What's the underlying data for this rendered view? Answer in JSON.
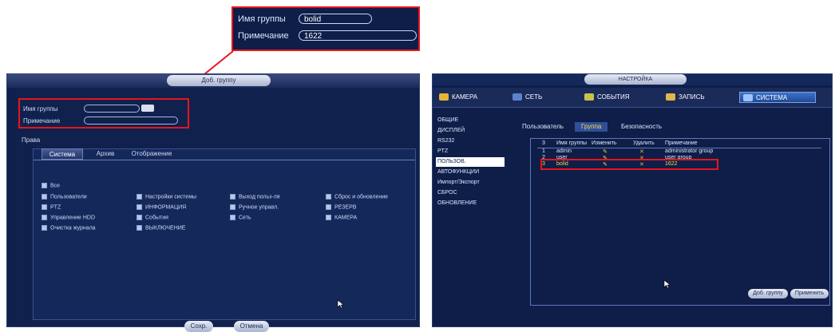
{
  "callout": {
    "group_name_label": "Имя группы",
    "group_name_value": "bolid",
    "note_label": "Примечание",
    "note_value": "1622"
  },
  "add_group_dialog": {
    "title": "Доб. группу",
    "group_name_label": "Имя группы",
    "note_label": "Примечание",
    "rights_label": "Права",
    "tabs": [
      "Система",
      "Архив",
      "Отображение"
    ],
    "checkboxes": [
      "Все",
      "Пользователи",
      "Настройки системы",
      "Выход польз-ля",
      "Сброс и обновление",
      "PTZ",
      "ИНФОРМАЦИЯ",
      "Ручное управл.",
      "РЕЗЕРВ",
      "Управление HDD",
      "События",
      "Сеть",
      "КАМЕРА",
      "Очистка журнала",
      "ВЫКЛЮЧЕНИЕ"
    ],
    "save_button": "Сохр.",
    "cancel_button": "Отмена"
  },
  "settings_window": {
    "title": "НАСТРОЙКА",
    "toolbar": [
      {
        "label": "КАМЕРА",
        "icon": "camera-icon"
      },
      {
        "label": "СЕТЬ",
        "icon": "network-icon"
      },
      {
        "label": "СОБЫТИЯ",
        "icon": "events-icon"
      },
      {
        "label": "ЗАПИСЬ",
        "icon": "record-icon"
      },
      {
        "label": "СИСТЕМА",
        "icon": "system-icon"
      }
    ],
    "sidebar": [
      "ОБЩИЕ",
      "ДИСПЛЕЙ",
      "RS232",
      "PTZ",
      "ПОЛЬЗОВ.",
      "АВТОФУНКЦИИ",
      "Импорт/Экспорт",
      "СБРОС",
      "ОБНОВЛЕНИЕ"
    ],
    "selected_sidebar": "ПОЛЬЗОВ.",
    "subtabs": [
      "Пользователь",
      "Группа",
      "Безопасность"
    ],
    "selected_subtab": "Группа",
    "table": {
      "headers": [
        "3",
        "Имя группы",
        "Изменить",
        "Удалить",
        "Примечание"
      ],
      "rows": [
        {
          "num": "1",
          "name": "admin",
          "edit": "✎",
          "del": "✕",
          "note": "administrator group"
        },
        {
          "num": "2",
          "name": "user",
          "edit": "✎",
          "del": "✕",
          "note": "user group"
        },
        {
          "num": "3",
          "name": "bolid",
          "edit": "✎",
          "del": "✕",
          "note": "1622"
        }
      ]
    },
    "add_group_button": "Доб. группу",
    "apply_button": "Применить"
  },
  "colors": {
    "highlight": "#e8141c",
    "background_dark": "#0e1e48",
    "accent_yellow": "#ffd640"
  }
}
